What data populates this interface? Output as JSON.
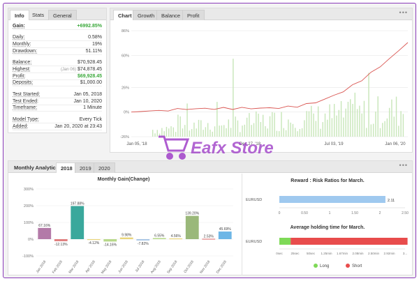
{
  "stats_panel": {
    "tabs": [
      "Info",
      "Stats",
      "General"
    ],
    "rows": [
      {
        "label": "Gain:",
        "value": "+6992.85%",
        "green": true
      },
      {
        "label": "Daily:",
        "value": "0.58%"
      },
      {
        "label": "Monthly:",
        "value": "19%"
      },
      {
        "label": "Drawdown:",
        "value": "51.11%"
      },
      {
        "label": "Balance:",
        "value": "$70,928.45"
      },
      {
        "label": "Highest:",
        "sub": "(Jan 06)",
        "value": "$74,878.45"
      },
      {
        "label": "Profit:",
        "value": "$69,928.45",
        "green": true
      },
      {
        "label": "Deposits:",
        "value": "$1,000.00"
      },
      {
        "label": "Test Started:",
        "value": "Jan 05, 2018"
      },
      {
        "label": "Test Ended:",
        "value": "Jan 10, 2020"
      },
      {
        "label": "Timeframe:",
        "value": "1 Minute"
      },
      {
        "label": "Model Type:",
        "value": "Every Tick"
      },
      {
        "label": "Added:",
        "value": "Jan 20, 2020 at 23:43"
      }
    ]
  },
  "chart_panel": {
    "tabs": [
      "Chart",
      "Growth",
      "Balance",
      "Profit"
    ],
    "menu": "•••"
  },
  "analytics_panel": {
    "tabs": [
      "Monthly Analytics",
      "2018",
      "2019",
      "2020"
    ],
    "menu": "•••"
  },
  "watermark": {
    "text": "Eafx Store"
  },
  "colors": {
    "accent_green": "#3aa83a",
    "growth_line": "#d9534f",
    "bar_green": "#c7e6b8",
    "frame": "#8a3ab9"
  },
  "chart_data": [
    {
      "type": "line",
      "title": "",
      "x_ticks": [
        "Jan 05, '18",
        "Dec 27, '18",
        "Jul 03, '19",
        "Jan 06, '20"
      ],
      "y_ticks": [
        "86%",
        "60%",
        "26%",
        "0%",
        "-26%"
      ],
      "ylim": [
        -26,
        86
      ],
      "series": [
        {
          "values": [
            0,
            0.5,
            1.2,
            1.8,
            2.3,
            2.8,
            3.2,
            3.5,
            3.6,
            3.7,
            3.8,
            3.9,
            4.0,
            4.0,
            4.1,
            4.2,
            4.6,
            5.2,
            6.3,
            8.0,
            10.4,
            13.5,
            17.5,
            22.2,
            27.8,
            34.2,
            41.0,
            48.5,
            56.2,
            64.5,
            73.5
          ]
        }
      ],
      "volume_bars_note": ""
    },
    {
      "type": "bar",
      "title": "Monthly Gain(Change)",
      "categories": [
        "Jan 2018",
        "Feb 2018",
        "Mar 2018",
        "Apr 2018",
        "May 2018",
        "Jun 2018",
        "Jul 2018",
        "Aug 2018",
        "Sep 2018",
        "Oct 2018",
        "Nov 2018",
        "Dec 2018"
      ],
      "values": [
        67.16,
        -12.13,
        197.88,
        -4.12,
        -14.16,
        9.98,
        -7.82,
        6.55,
        4.56,
        139.2,
        2.53,
        45.69
      ],
      "labels": [
        "67.16%",
        "-12.13%",
        "197.88%",
        "-4.12%",
        "-14.16%",
        "9.98%",
        "-7.82%",
        "6.55%",
        "4.56%",
        "139.20%",
        "2.53%",
        "45.69%"
      ],
      "y_ticks": [
        "300%",
        "200%",
        "100%",
        "0%",
        "-100%"
      ],
      "ylim": [
        -100,
        300
      ],
      "colors": [
        "#b37aa8",
        "#e07d7d",
        "#3aa89c",
        "#e9d57a",
        "#b8d98a",
        "#e9d57a",
        "#a6c4e5",
        "#b8d98a",
        "#e9d57a",
        "#9ab87a",
        "#e07d7d",
        "#6db6e6"
      ]
    },
    {
      "type": "bar",
      "title": "Reward : Risk Ratios for March.",
      "categories": [
        "EURUSD"
      ],
      "values": [
        2.11
      ],
      "label": "2.11",
      "x_ticks": [
        "0",
        "0.50",
        "1",
        "1.50",
        "2",
        "2.50"
      ],
      "xlim": [
        0,
        2.5
      ],
      "color": "#9fc9ef"
    },
    {
      "type": "bar",
      "title": "Average holding time for March.",
      "categories": [
        "EURUSD"
      ],
      "series": [
        {
          "name": "Long",
          "value_sec": 18,
          "color": "#7ed957"
        },
        {
          "name": "Short",
          "value_sec": 186,
          "color": "#e84c4c"
        }
      ],
      "x_ticks": [
        "0sec",
        "25sec",
        "50sec",
        "1.25min",
        "1.67min",
        "2.08min",
        "2.50min",
        "2.92min",
        "3..."
      ],
      "legend": [
        "Long",
        "Short"
      ],
      "legend_placement": "bottom"
    }
  ]
}
